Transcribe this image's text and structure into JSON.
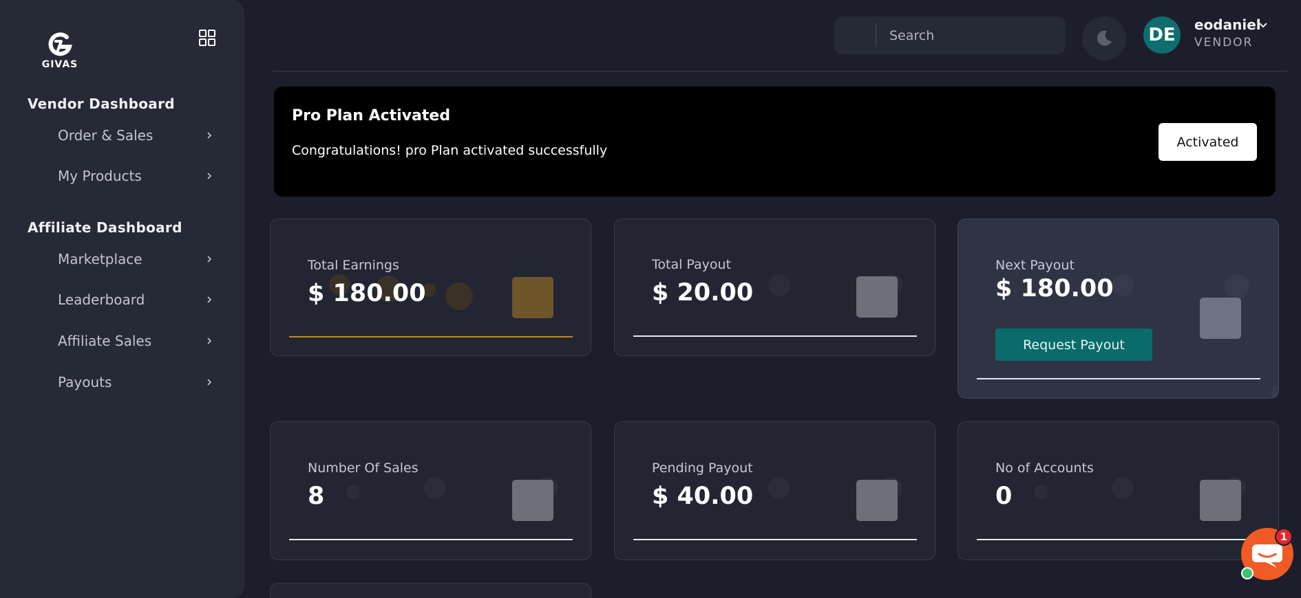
{
  "brand": {
    "logo_text": "GIVAS"
  },
  "sidebar": {
    "sections": [
      {
        "title": "Vendor Dashboard",
        "items": [
          {
            "label": "Order & Sales"
          },
          {
            "label": "My Products"
          }
        ]
      },
      {
        "title": "Affiliate Dashboard",
        "items": [
          {
            "label": "Marketplace"
          },
          {
            "label": "Leaderboard"
          },
          {
            "label": "Affiliate Sales"
          },
          {
            "label": "Payouts"
          }
        ]
      }
    ]
  },
  "header": {
    "search_placeholder": "Search",
    "user": {
      "initials": "DE",
      "name": "eodaniel",
      "role": "VENDOR",
      "avatar_color": "#0e6e6f"
    }
  },
  "banner": {
    "title": "Pro Plan Activated",
    "message": "Congratulations! pro Plan activated successfully",
    "button_label": "Activated"
  },
  "cards": [
    {
      "label": "Total Earnings",
      "value": "$ 180.00",
      "accent": "#b88b2c"
    },
    {
      "label": "Total Payout",
      "value": "$ 20.00"
    },
    {
      "label": "Next Payout",
      "value": "$ 180.00",
      "button_label": "Request Payout",
      "button_color": "#0a6b6b"
    },
    {
      "label": "Number Of Sales",
      "value": "8"
    },
    {
      "label": "Pending Payout",
      "value": "$ 40.00"
    },
    {
      "label": "No of Accounts",
      "value": "0"
    }
  ],
  "chat": {
    "badge_count": "1",
    "color": "#f05a25"
  }
}
